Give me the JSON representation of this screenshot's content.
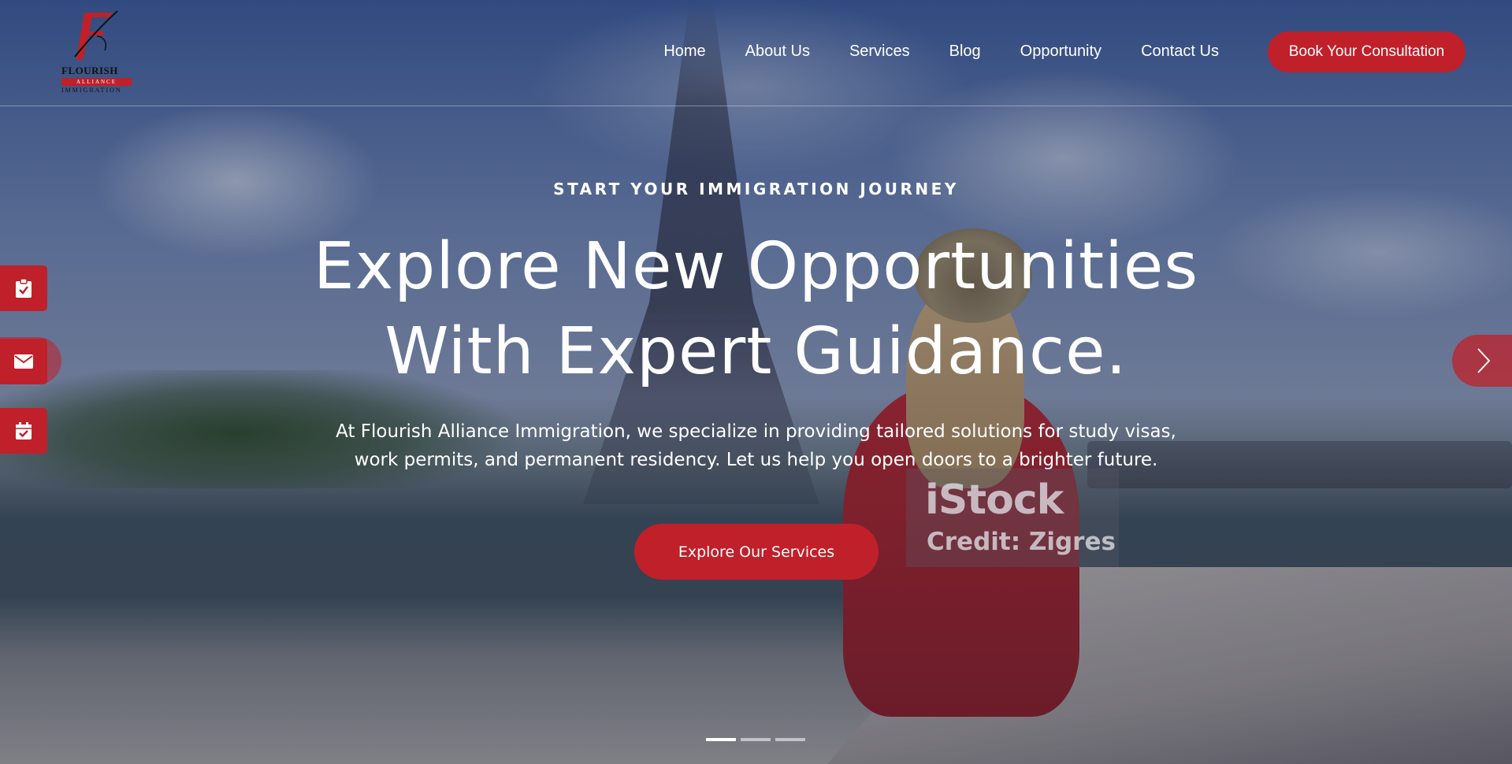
{
  "brand": {
    "name_line1": "FLOURISH",
    "name_line2": "ALLIANCE",
    "name_line3": "IMMIGRATION",
    "accent_color": "#c0202a"
  },
  "nav": {
    "items": [
      "Home",
      "About Us",
      "Services",
      "Blog",
      "Opportunity",
      "Contact Us"
    ],
    "cta_label": "Book Your Consultation"
  },
  "hero": {
    "eyebrow": "START YOUR IMMIGRATION JOURNEY",
    "headline_line1": "Explore New Opportunities",
    "headline_line2": "With Expert Guidance.",
    "subtitle": "At Flourish Alliance Immigration, we specialize in providing tailored solutions for study visas, work permits, and permanent residency. Let us help you open doors to a brighter future.",
    "button_label": "Explore Our Services"
  },
  "watermark": {
    "brand": "iStock",
    "credit": "Credit: Zigres"
  },
  "side_buttons": [
    {
      "icon": "clipboard-check-icon"
    },
    {
      "icon": "envelope-icon"
    },
    {
      "icon": "calendar-check-icon"
    }
  ],
  "slider": {
    "slide_count": 3,
    "active_slide": 1,
    "next_icon": "chevron-right-icon"
  }
}
